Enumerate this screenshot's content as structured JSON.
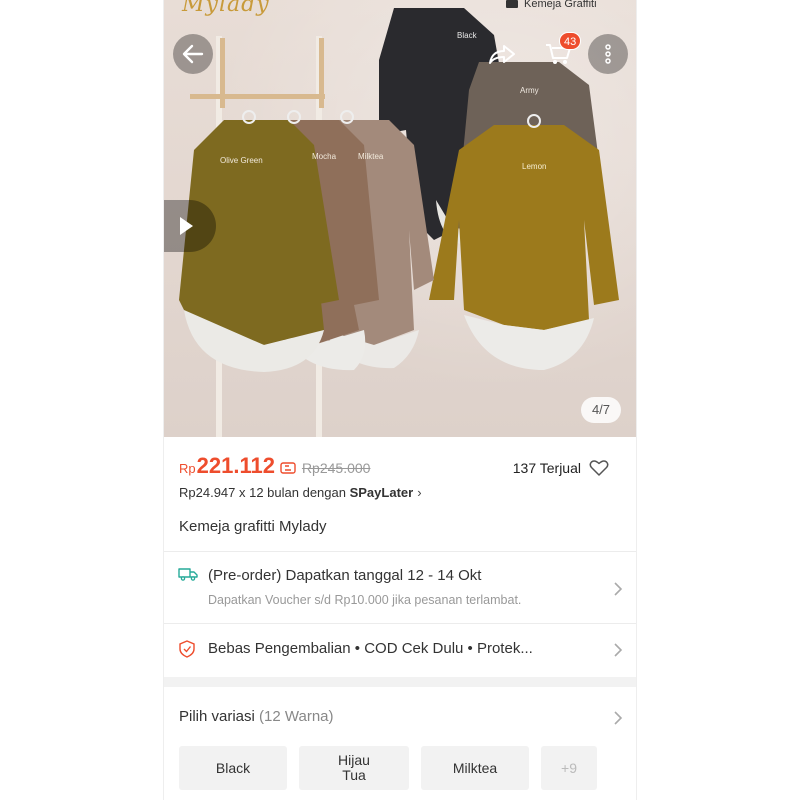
{
  "header": {
    "brand_logo": "Mylady",
    "brand_caption": "Kemeja Graffiti",
    "cart_count": "43"
  },
  "gallery": {
    "counter": "4/7",
    "shirt_labels": [
      "Olive Green",
      "Mocha",
      "Milktea",
      "Black",
      "Army",
      "Lemon"
    ]
  },
  "price": {
    "currency": "Rp",
    "current": "221.112",
    "original": "Rp245.000",
    "sold": "137 Terjual"
  },
  "installment": {
    "prefix": "Rp24.947 x 12 bulan dengan ",
    "provider": "SPayLater",
    "chevron": "›"
  },
  "product": {
    "title": "Kemeja grafitti Mylady"
  },
  "shipping": {
    "title": "(Pre-order) Dapatkan tanggal 12 - 14 Okt",
    "subtitle": "Dapatkan Voucher s/d Rp10.000 jika pesanan terlambat."
  },
  "guarantee": {
    "text": "Bebas Pengembalian  •  COD Cek Dulu  •  Protek..."
  },
  "variation": {
    "label": "Pilih variasi",
    "count": "(12 Warna)",
    "options": [
      "Black",
      "Hijau\nTua",
      "Milktea",
      "+9"
    ]
  },
  "colors": {
    "accent": "#ee4d2d",
    "teal": "#26aa99"
  },
  "icons": {
    "back": "arrow-left-icon",
    "share": "share-icon",
    "cart": "cart-icon",
    "more": "more-vertical-icon",
    "play": "play-icon",
    "heart": "heart-icon",
    "truck": "truck-icon",
    "shield": "shield-icon",
    "chevron": "chevron-right-icon"
  }
}
